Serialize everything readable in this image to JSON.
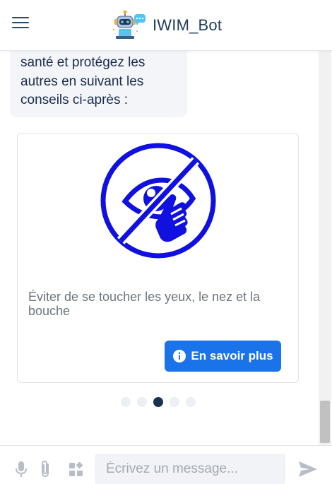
{
  "header": {
    "title": "IWIM_Bot",
    "menu_icon": "hamburger-menu-icon",
    "logo_icon": "robot-logo-icon"
  },
  "chat": {
    "bot_message": "santé et protégez les autres en suivant les conseils ci-après :",
    "card": {
      "illustration_icon": "no-touching-eyes-icon",
      "text": "Éviter de se toucher les yeux, le nez et la bouche",
      "button_label": "En savoir plus",
      "button_icon": "info-icon"
    },
    "carousel": {
      "dot_count": 5,
      "active_index": 2
    }
  },
  "composer": {
    "placeholder": "Écrivez un message...",
    "value": "",
    "icons": [
      "microphone-icon",
      "paperclip-icon",
      "apps-icon",
      "send-icon"
    ]
  },
  "colors": {
    "accent": "#1a73e8",
    "illustration": "#1010e0",
    "active_dot": "#1a3152",
    "title": "#1f3b5c"
  }
}
